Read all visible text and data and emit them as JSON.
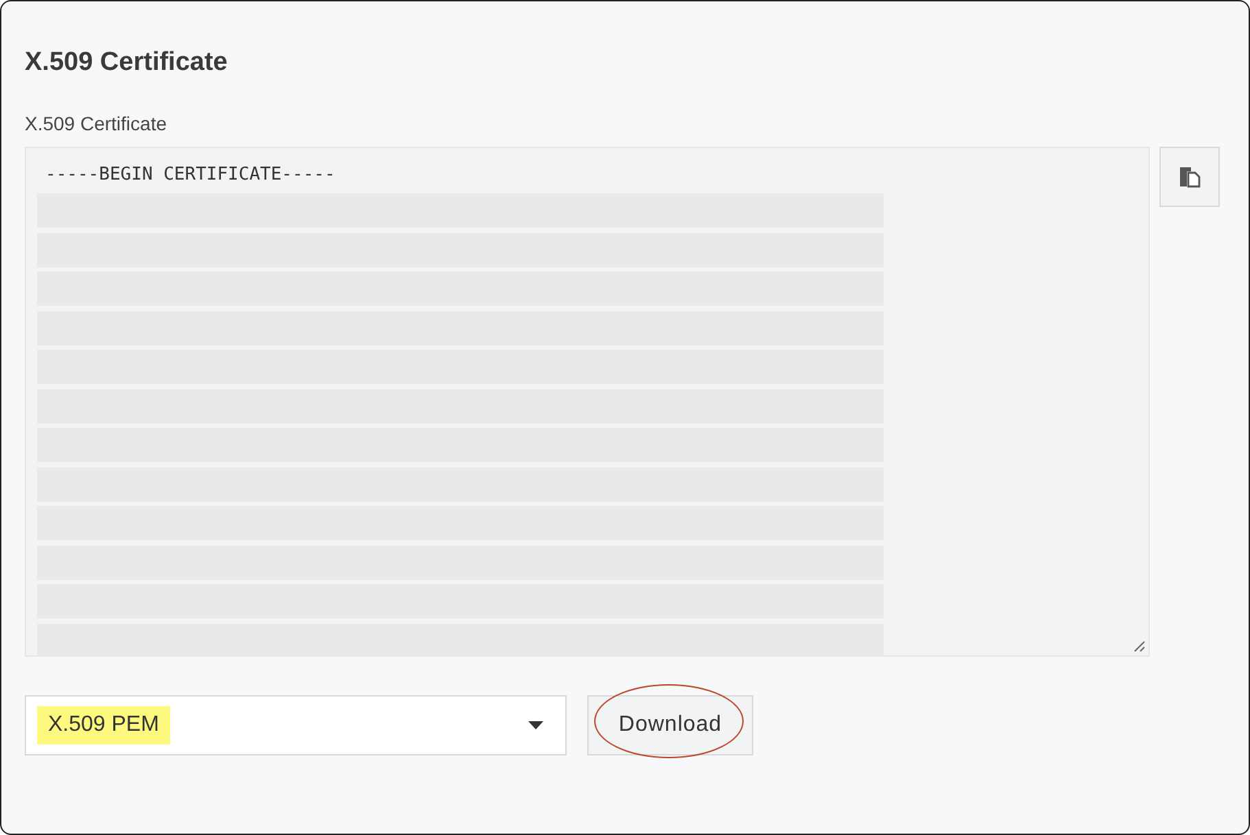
{
  "title": "X.509 Certificate",
  "certificate": {
    "label": "X.509 Certificate",
    "first_line": "-----BEGIN CERTIFICATE-----"
  },
  "format_select": {
    "value": "X.509 PEM",
    "highlighted": true
  },
  "download_button": {
    "label": "Download",
    "circled": true
  }
}
